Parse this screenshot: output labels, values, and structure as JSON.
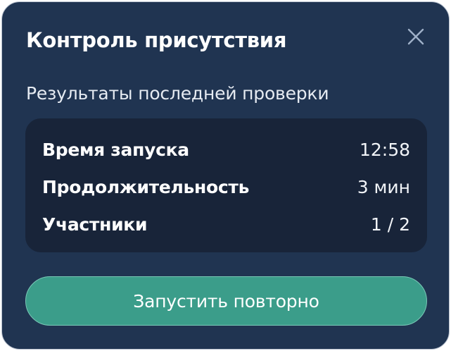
{
  "dialog": {
    "title": "Контроль присутствия",
    "close_icon": "close-icon",
    "subtitle": "Результаты последней проверки",
    "results": [
      {
        "label": "Время запуска",
        "value": "12:58"
      },
      {
        "label": "Продолжительность",
        "value": "3 мин"
      },
      {
        "label": "Участники",
        "value": "1 / 2"
      }
    ],
    "restart_label": "Запустить повторно"
  },
  "colors": {
    "dialog_background": "#203451",
    "panel_background": "#182439",
    "accent_button": "#3b9d8a",
    "text": "#ffffff"
  }
}
